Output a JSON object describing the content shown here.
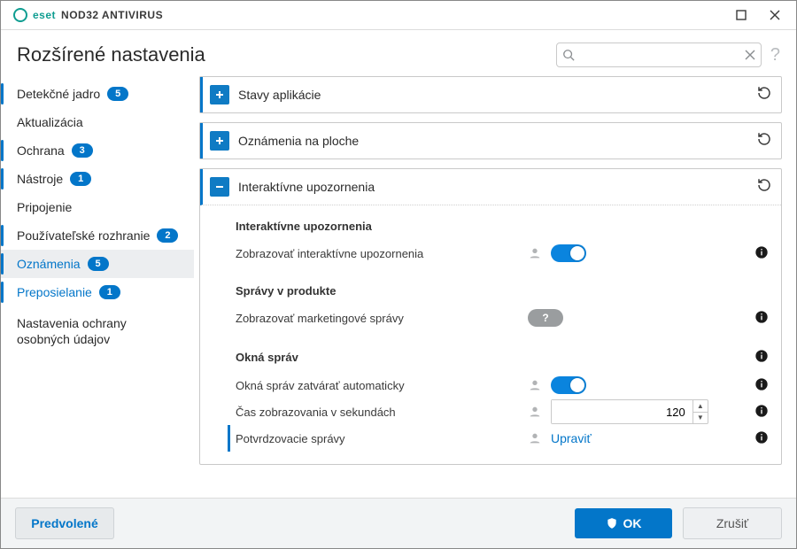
{
  "app": {
    "brand_left": "eset",
    "brand_right": "NOD32 ANTIVIRUS",
    "page_title": "Rozšírené nastavenia"
  },
  "search": {
    "placeholder": ""
  },
  "sidebar": {
    "items": [
      {
        "label": "Detekčné jadro",
        "badge": "5"
      },
      {
        "label": "Aktualizácia",
        "badge": null
      },
      {
        "label": "Ochrana",
        "badge": "3"
      },
      {
        "label": "Nástroje",
        "badge": "1"
      },
      {
        "label": "Pripojenie",
        "badge": null
      },
      {
        "label": "Používateľské rozhranie",
        "badge": "2"
      }
    ],
    "sub": [
      {
        "label": "Oznámenia",
        "badge": "5"
      },
      {
        "label": "Preposielanie",
        "badge": "1"
      }
    ],
    "plain": "Nastavenia ochrany osobných údajov"
  },
  "panels": {
    "app_states": {
      "title": "Stavy aplikácie"
    },
    "desktop_notif": {
      "title": "Oznámenia na ploche"
    },
    "interactive": {
      "title": "Interaktívne upozornenia",
      "sec1_title": "Interaktívne upozornenia",
      "row1_label": "Zobrazovať interaktívne upozornenia",
      "sec2_title": "Správy v produkte",
      "row2_label": "Zobrazovať marketingové správy",
      "sec3_title": "Okná správ",
      "row3_label": "Okná správ zatvárať automaticky",
      "row4_label": "Čas zobrazovania v sekundách",
      "row4_value": "120",
      "row5_label": "Potvrdzovacie správy",
      "row5_link": "Upraviť"
    }
  },
  "footer": {
    "default": "Predvolené",
    "ok": "OK",
    "cancel": "Zrušiť"
  },
  "colors": {
    "brand_blue": "#0376c9",
    "brand_teal": "#0f9d91",
    "toggle_on": "#0a84de"
  }
}
